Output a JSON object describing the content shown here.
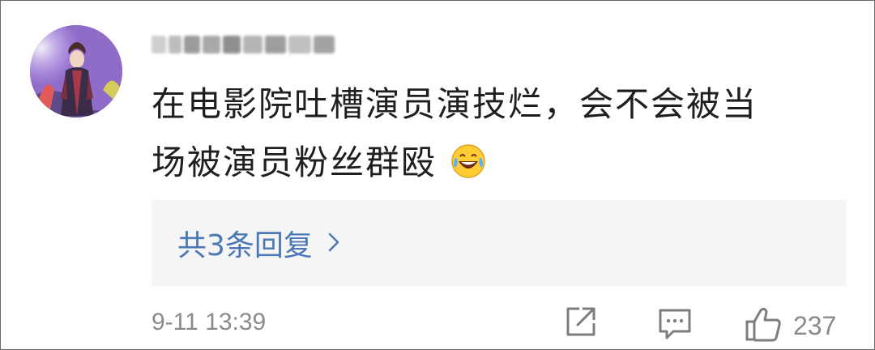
{
  "comment": {
    "line1": "在电影院吐槽演员演技烂，会不会被当",
    "line2": "场被演员粉丝群殴",
    "emoji": "laughing-tears-emoji"
  },
  "replies": {
    "label": "共3条回复"
  },
  "meta": {
    "timestamp": "9-11 13:39",
    "like_count": "237"
  },
  "icons": {
    "share": "share-icon",
    "comment": "comment-icon",
    "like": "thumbs-up-icon",
    "chevron": "chevron-right-icon"
  },
  "colors": {
    "text": "#1f1f1f",
    "link": "#4a78b5",
    "muted": "#8a8a8a",
    "reply_bg": "#f5f5f5"
  }
}
